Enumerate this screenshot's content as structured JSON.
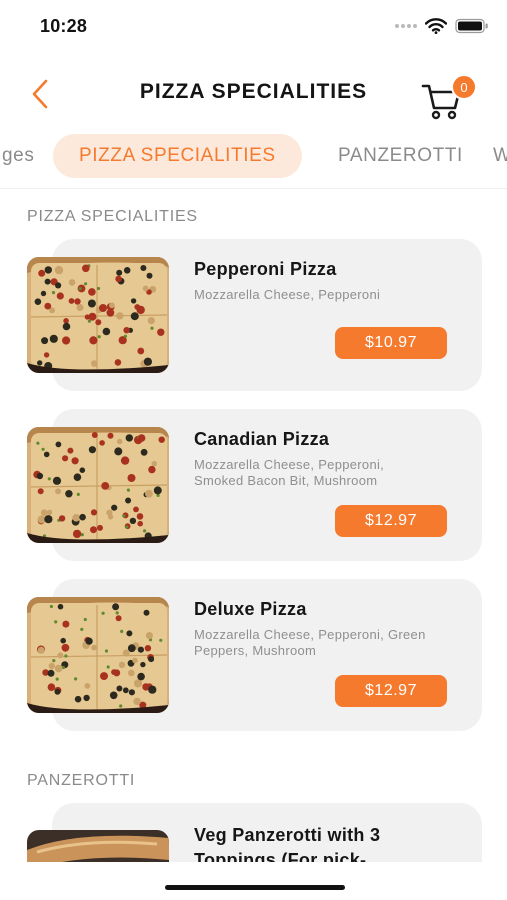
{
  "status_bar": {
    "time": "10:28"
  },
  "header": {
    "title": "PIZZA SPECIALITIES",
    "cart_count": "0"
  },
  "tabs": [
    {
      "label": "ges"
    },
    {
      "label": "PIZZA SPECIALITIES",
      "active": true
    },
    {
      "label": "PANZEROTTI"
    },
    {
      "label": "W"
    }
  ],
  "sections": [
    {
      "title": "PIZZA SPECIALITIES",
      "items": [
        {
          "name": "Pepperoni Pizza",
          "description": "Mozzarella Cheese, Pepperoni",
          "price": "$10.97"
        },
        {
          "name": "Canadian Pizza",
          "description": "Mozzarella Cheese, Pepperoni, Smoked Bacon Bit, Mushroom",
          "price": "$12.97"
        },
        {
          "name": "Deluxe Pizza",
          "description": "Mozzarella Cheese, Pepperoni, Green Peppers, Mushroom",
          "price": "$12.97"
        }
      ]
    },
    {
      "title": "PANZEROTTI",
      "items": [
        {
          "name": "Veg Panzerotti with 3 Toppings (For pick-"
        }
      ]
    }
  ],
  "colors": {
    "accent": "#f57a2e",
    "accent_light": "#fde9dc",
    "card_bg": "#f1f1f1",
    "muted_text": "#8a8a8a"
  }
}
